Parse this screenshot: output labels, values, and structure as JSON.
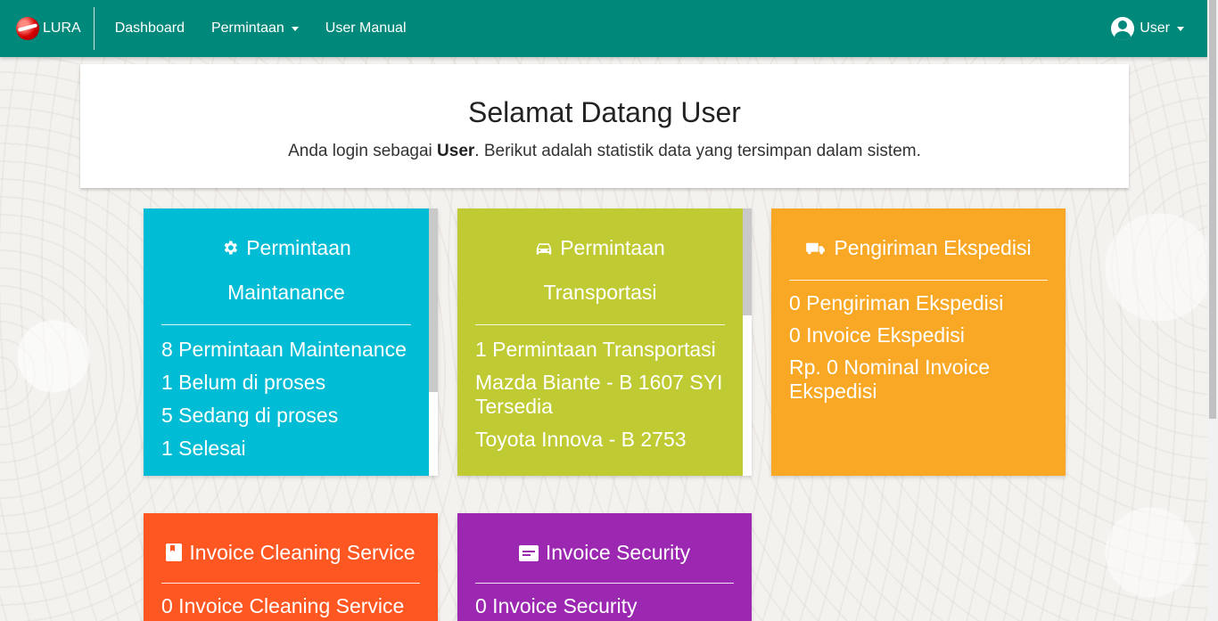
{
  "navbar": {
    "brand": "LURA",
    "links": [
      {
        "label": "Dashboard"
      },
      {
        "label": "Permintaan"
      },
      {
        "label": "User Manual"
      }
    ],
    "user_label": "User"
  },
  "welcome": {
    "title": "Selamat Datang User",
    "sub_prefix": "Anda login sebagai ",
    "sub_bold": "User",
    "sub_suffix": ". Berikut adalah statistik data yang tersimpan dalam sistem."
  },
  "cards": {
    "maintenance": {
      "color": "#00bcd4",
      "icon": "gear-icon",
      "title_line1": "Permintaan",
      "title_line2": "Maintanance",
      "items": [
        "8 Permintaan Maintenance",
        "1 Belum di proses",
        "5 Sedang di proses",
        "1 Selesai"
      ]
    },
    "transport": {
      "color": "#c0ca33",
      "icon": "car-icon",
      "title_line1": "Permintaan",
      "title_line2": "Transportasi",
      "items": [
        "1 Permintaan Transportasi",
        "Mazda Biante - B 1607 SYI Tersedia",
        "Toyota Innova - B 2753"
      ]
    },
    "ekspedisi": {
      "color": "#f9a825",
      "icon": "truck-icon",
      "title": "Pengiriman Ekspedisi",
      "items": [
        "0 Pengiriman Ekspedisi",
        "0 Invoice Ekspedisi",
        "Rp. 0 Nominal Invoice Ekspedisi"
      ]
    },
    "cleaning": {
      "color": "#ff5722",
      "icon": "book-icon",
      "title": "Invoice Cleaning Service",
      "items": [
        "0 Invoice Cleaning Service"
      ]
    },
    "security": {
      "color": "#9c27b0",
      "icon": "card-icon",
      "title": "Invoice Security",
      "items": [
        "0 Invoice Security"
      ]
    }
  }
}
